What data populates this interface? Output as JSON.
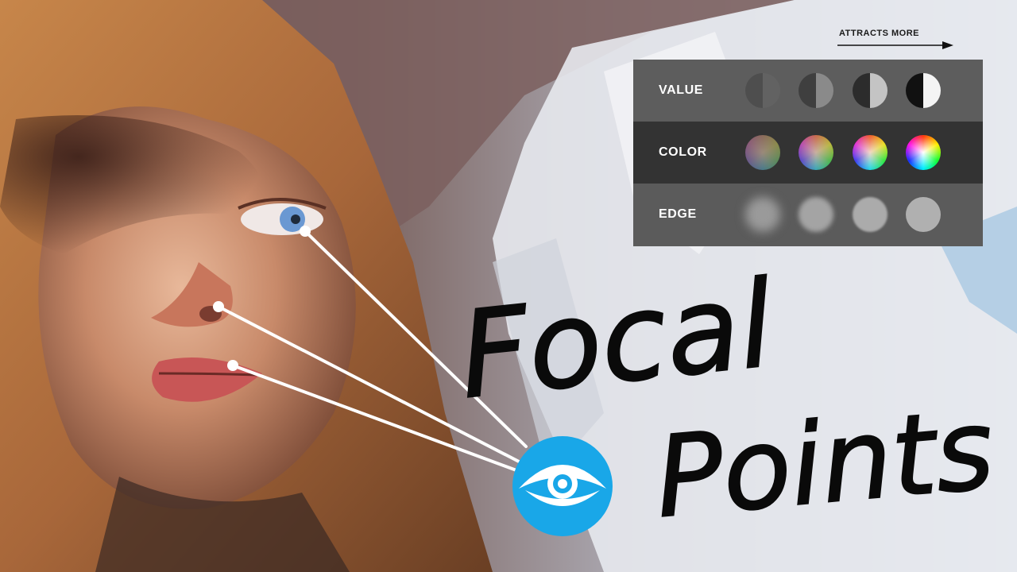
{
  "legend": {
    "direction_label": "ATTRACTS MORE",
    "rows": [
      {
        "label": "VALUE",
        "swatches": [
          "value-contrast-1",
          "value-contrast-2",
          "value-contrast-3",
          "value-contrast-4"
        ]
      },
      {
        "label": "COLOR",
        "swatches": [
          "color-saturation-1",
          "color-saturation-2",
          "color-saturation-3",
          "color-saturation-4"
        ]
      },
      {
        "label": "EDGE",
        "swatches": [
          "edge-softness-1",
          "edge-softness-2",
          "edge-softness-3",
          "edge-softness-4"
        ]
      }
    ]
  },
  "title": {
    "line1": "Focal",
    "line2": "Points"
  },
  "focal_targets": [
    "eye",
    "nose",
    "mouth"
  ],
  "icon": "eye-icon",
  "colors": {
    "badge": "#19a7e8",
    "panel_light": "#5d5d5d",
    "panel_dark": "#333333",
    "lines": "#ffffff"
  }
}
